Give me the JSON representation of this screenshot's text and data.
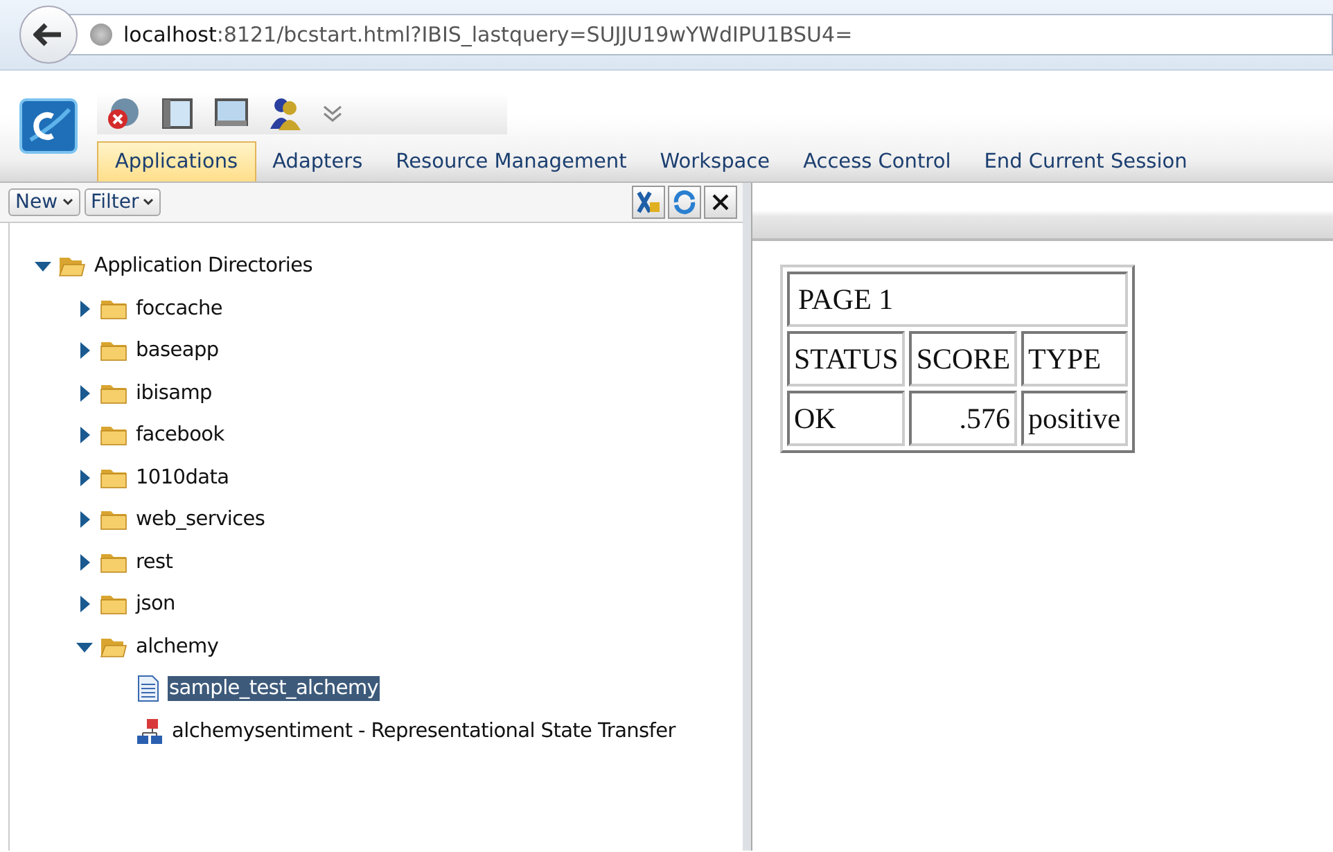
{
  "browser": {
    "url_host": "localhost",
    "url_rest": ":8121/bcstart.html?IBIS_lastquery=SUJJU19wYWdIPU1BSU4="
  },
  "menu_tabs": [
    {
      "label": "Applications",
      "selected": true
    },
    {
      "label": "Adapters",
      "selected": false
    },
    {
      "label": "Resource Management",
      "selected": false
    },
    {
      "label": "Workspace",
      "selected": false
    },
    {
      "label": "Access Control",
      "selected": false
    },
    {
      "label": "End Current Session",
      "selected": false
    }
  ],
  "panel_toolbar": {
    "dropdowns": [
      "New",
      "Filter"
    ]
  },
  "tree": [
    {
      "label": "Application Directories",
      "kind": "folder",
      "expanded": true,
      "selected": false,
      "children": [
        {
          "label": "foccache",
          "kind": "folder",
          "expanded": false,
          "selected": false
        },
        {
          "label": "baseapp",
          "kind": "folder",
          "expanded": false,
          "selected": false
        },
        {
          "label": "ibisamp",
          "kind": "folder",
          "expanded": false,
          "selected": false
        },
        {
          "label": "facebook",
          "kind": "folder",
          "expanded": false,
          "selected": false
        },
        {
          "label": "1010data",
          "kind": "folder",
          "expanded": false,
          "selected": false
        },
        {
          "label": "web_services",
          "kind": "folder",
          "expanded": false,
          "selected": false
        },
        {
          "label": "rest",
          "kind": "folder",
          "expanded": false,
          "selected": false
        },
        {
          "label": "json",
          "kind": "folder",
          "expanded": false,
          "selected": false
        },
        {
          "label": "alchemy",
          "kind": "folder",
          "expanded": true,
          "selected": false,
          "children": [
            {
              "label": "sample_test_alchemy",
              "kind": "document",
              "selected": true
            },
            {
              "label": "alchemysentiment - Representational State Transfer",
              "kind": "adapter",
              "selected": false
            }
          ]
        }
      ]
    }
  ],
  "report": {
    "title": "PAGE 1",
    "columns": [
      "STATUS",
      "SCORE",
      "TYPE"
    ],
    "rows": [
      [
        "OK",
        ".576",
        "positive"
      ]
    ]
  }
}
